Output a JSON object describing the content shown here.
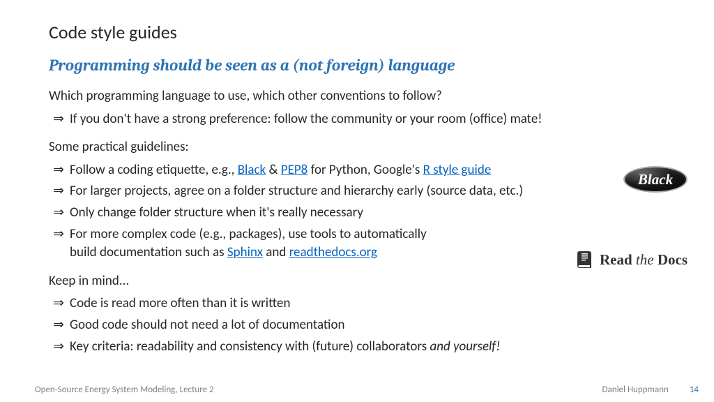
{
  "title": "Code style guides",
  "subtitle": "Programming should be seen as a (not foreign) language",
  "section1": {
    "lead": "Which programming language to use, which other conventions to follow?",
    "items": [
      "If you don't have a strong preference: follow the community or your room (office) mate!"
    ]
  },
  "section2": {
    "lead": "Some practical guidelines:",
    "item1_pre": "Follow a coding etiquette, e.g., ",
    "item1_link1": "Black",
    "item1_mid1": " & ",
    "item1_link2": "PEP8",
    "item1_mid2": " for Python, Google's ",
    "item1_link3": "R style guide",
    "item2": "For larger projects, agree on a folder structure and hierarchy early (source data, etc.)",
    "item3": "Only change folder structure when it's really necessary",
    "item4_pre": "For more complex code (e.g., packages), use tools to automatically",
    "item4_br": "build documentation such as ",
    "item4_link1": "Sphinx",
    "item4_mid": " and ",
    "item4_link2": "readthedocs.org"
  },
  "section3": {
    "lead": "Keep in mind...",
    "item1": "Code is read more often than it is written",
    "item2": "Good code should not need a lot of documentation",
    "item3_pre": "Key criteria: readability and consistency with (future) collaborators ",
    "item3_em": "and yourself!"
  },
  "logos": {
    "black": "Black",
    "rtd_read": "Read ",
    "rtd_the": "the ",
    "rtd_docs": "Docs"
  },
  "footer": {
    "left": "Open-Source Energy System Modeling, Lecture 2",
    "author": "Daniel Huppmann",
    "page": "14"
  }
}
